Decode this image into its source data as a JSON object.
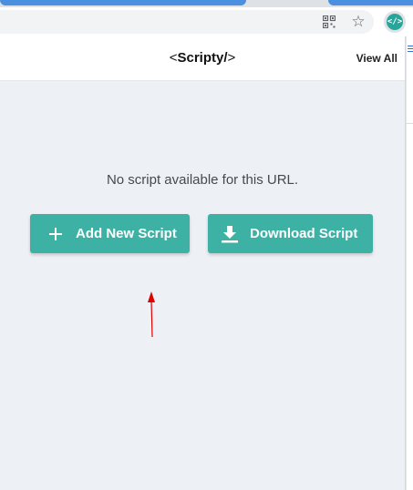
{
  "browser": {
    "icons": [
      "qr-code-icon",
      "star-icon",
      "extension-icon"
    ],
    "extension_badge": "</>"
  },
  "popup": {
    "title_left": "<",
    "title_main": "Scripty/",
    "title_right": ">",
    "view_all_label": "View All",
    "empty_message": "No script available for this URL.",
    "add_button_label": "Add New Script",
    "download_button_label": "Download Script"
  },
  "colors": {
    "accent": "#3eb1a5",
    "background": "#edf1f5",
    "annotation_arrow": "#e00000"
  }
}
